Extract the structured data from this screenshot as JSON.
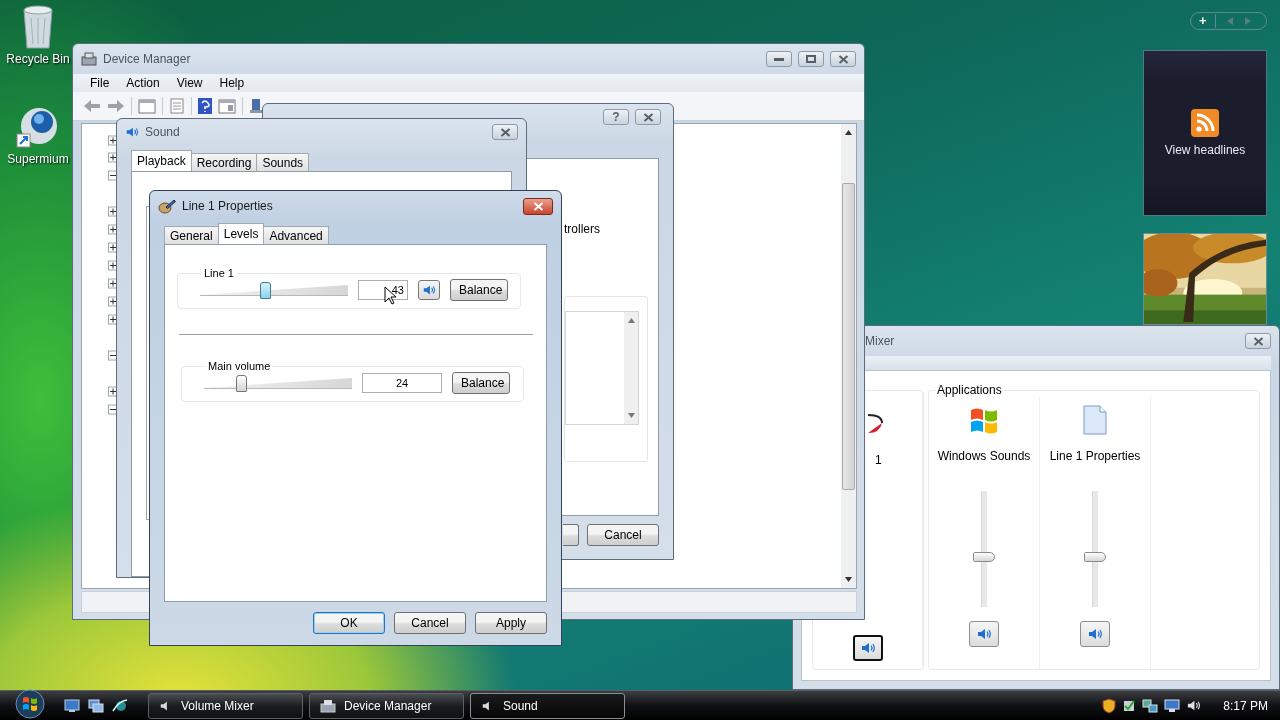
{
  "desktop_icons": [
    {
      "label": "Recycle Bin",
      "kind": "recycle-bin"
    },
    {
      "label": "Supermium",
      "kind": "browser"
    }
  ],
  "gadgets": {
    "add_button": "+",
    "feed": {
      "label": "View headlines"
    }
  },
  "volume_mixer": {
    "title": "Mixer",
    "device": {
      "label": "1"
    },
    "applications_label": "Applications",
    "apps": [
      {
        "name": "Windows Sounds",
        "kind": "windows-logo",
        "level": 0.44
      },
      {
        "name": "Line 1 Properties",
        "kind": "document",
        "level": 0.44
      }
    ]
  },
  "device_manager": {
    "title": "Device Manager",
    "menu": [
      "File",
      "Action",
      "View",
      "Help"
    ]
  },
  "properties_dialog": {
    "help_button": "?",
    "text": "trollers",
    "cancel_button": "Cancel"
  },
  "sound": {
    "title": "Sound",
    "tabs": [
      {
        "label": "Playback",
        "selected": true
      },
      {
        "label": "Recording",
        "selected": false
      },
      {
        "label": "Sounds",
        "selected": false
      }
    ]
  },
  "line_properties": {
    "title": "Line 1 Properties",
    "tabs": [
      {
        "label": "General",
        "selected": false
      },
      {
        "label": "Levels",
        "selected": true
      },
      {
        "label": "Advanced",
        "selected": false
      }
    ],
    "levels": [
      {
        "label": "Line 1",
        "level": 0.43,
        "value": "43",
        "mute_button": true,
        "balance": "Balance"
      },
      {
        "label": "Main volume",
        "level": 0.24,
        "value": "24",
        "mute_button": false,
        "balance": "Balance"
      }
    ],
    "buttons": [
      {
        "label": "OK",
        "default": true
      },
      {
        "label": "Cancel",
        "default": false
      },
      {
        "label": "Apply",
        "default": false
      }
    ]
  },
  "taskbar": {
    "buttons": [
      {
        "label": "Volume Mixer",
        "kind": "speaker",
        "selected": false
      },
      {
        "label": "Device Manager",
        "kind": "device-manager",
        "selected": false
      },
      {
        "label": "Sound",
        "kind": "speaker",
        "selected": true
      }
    ],
    "clock": "8:17 PM"
  }
}
